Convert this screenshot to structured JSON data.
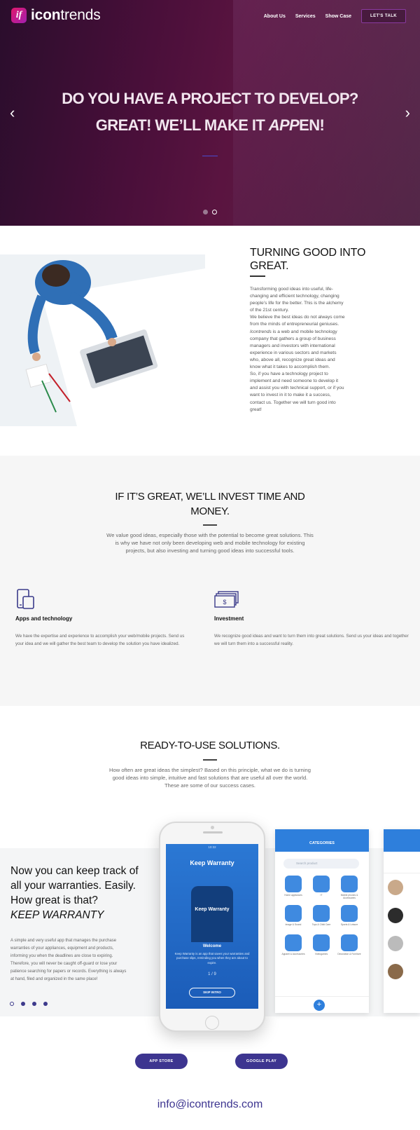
{
  "brand": {
    "logo_letter": "if",
    "name_bold": "icon",
    "name_rest": "trends"
  },
  "nav": {
    "items": [
      "About Us",
      "Services",
      "Show Case"
    ],
    "cta": "LET'S TALK"
  },
  "hero": {
    "line1": "DO YOU HAVE A PROJECT TO DEVELOP?",
    "line2_pre": "GREAT! WE’LL MAKE IT ",
    "line2_em": "APP",
    "line2_post": "EN!",
    "prev": "‹",
    "next": "›"
  },
  "about": {
    "title": "TURNING GOOD INTO GREAT.",
    "p1": "Transforming good ideas into useful, life-changing and efficient technology, changing people’s life for the better. This is the alchemy of the 21st century.",
    "p2_pre": "We believe the best ideas do not always come from the minds of entrepreneurial geniuses. ",
    "p2_em": "Icontrends",
    "p2_post": " is a web and mobile technology company that gathers a group of business managers and investors with international experience in various sectors and markets who, above all, recognize great ideas and know what it takes to accomplish them.",
    "p3": "So, if you have a technology project to implement and need someone to develop it and assist you with technical support, or if you want to invest in it to make it a success, contact us. Together we will turn good into great!"
  },
  "invest": {
    "title": "IF IT’S GREAT, WE’LL INVEST TIME AND MONEY.",
    "body": "We value good ideas, especially those with the potential to become great solutions. This is why we have not only been developing web and mobile technology for existing projects, but also investing and turning good ideas into successful tools.",
    "features": [
      {
        "icon": "devices-icon",
        "title": "Apps and technology",
        "body": "We have the expertise and experience to accomplish your web/mobile projects. Send us your idea and we will gather the best team to develop the solution you have idealized."
      },
      {
        "icon": "money-icon",
        "title": "Investment",
        "body": "We recognize good ideas and want to turn them into great solutions. Send us your ideas and together we will turn them into a successful reality."
      }
    ]
  },
  "solutions": {
    "title": "READY-TO-USE SOLUTIONS.",
    "body": "How often are great ideas the simplest? Based on this principle, what we do is turning good ideas into simple, intuitive and fast solutions that are useful all over the world. These are some of our success cases.",
    "promo_title": "Now you can keep track of all your warranties. Easily. How great is that?",
    "promo_em": "KEEP WARRANTY",
    "promo_body": "A simple and very useful app that manages the purchase warranties of your appliances, equipment and products, informing you when the deadlines are close to expiring. Therefore, you will never be caught off-guard or lose your patience searching for papers or records. Everything is always at hand, filed and organized in the same place!"
  },
  "phone_screen": {
    "status": "10:32",
    "logo": "Keep Warranty",
    "welcome": "Welcome",
    "desc": "Keep Warranty is an app that saves your warranties and purchase slips, reminding you when they are about to expire.",
    "pager": "1 / 9",
    "skip": "SKIP INTRO"
  },
  "categories_screen": {
    "title": "CATEGORIES",
    "search": "Search product",
    "items": [
      "Home appliances",
      "IT",
      "Mobile phones & Accessories",
      "Image & Sound",
      "Toys & Child Care",
      "Sports & Leisure",
      "Apparel & Accessories",
      "Videogames",
      "Decoration & Furniture"
    ]
  },
  "store": {
    "app_store": "APP STORE",
    "google_play": "GOOGLE PLAY"
  },
  "email": "info@icontrends.com",
  "colors": {
    "accent": "#3d3590",
    "hero_bg": "#4a0f3a",
    "app_blue": "#2e7fdc"
  }
}
